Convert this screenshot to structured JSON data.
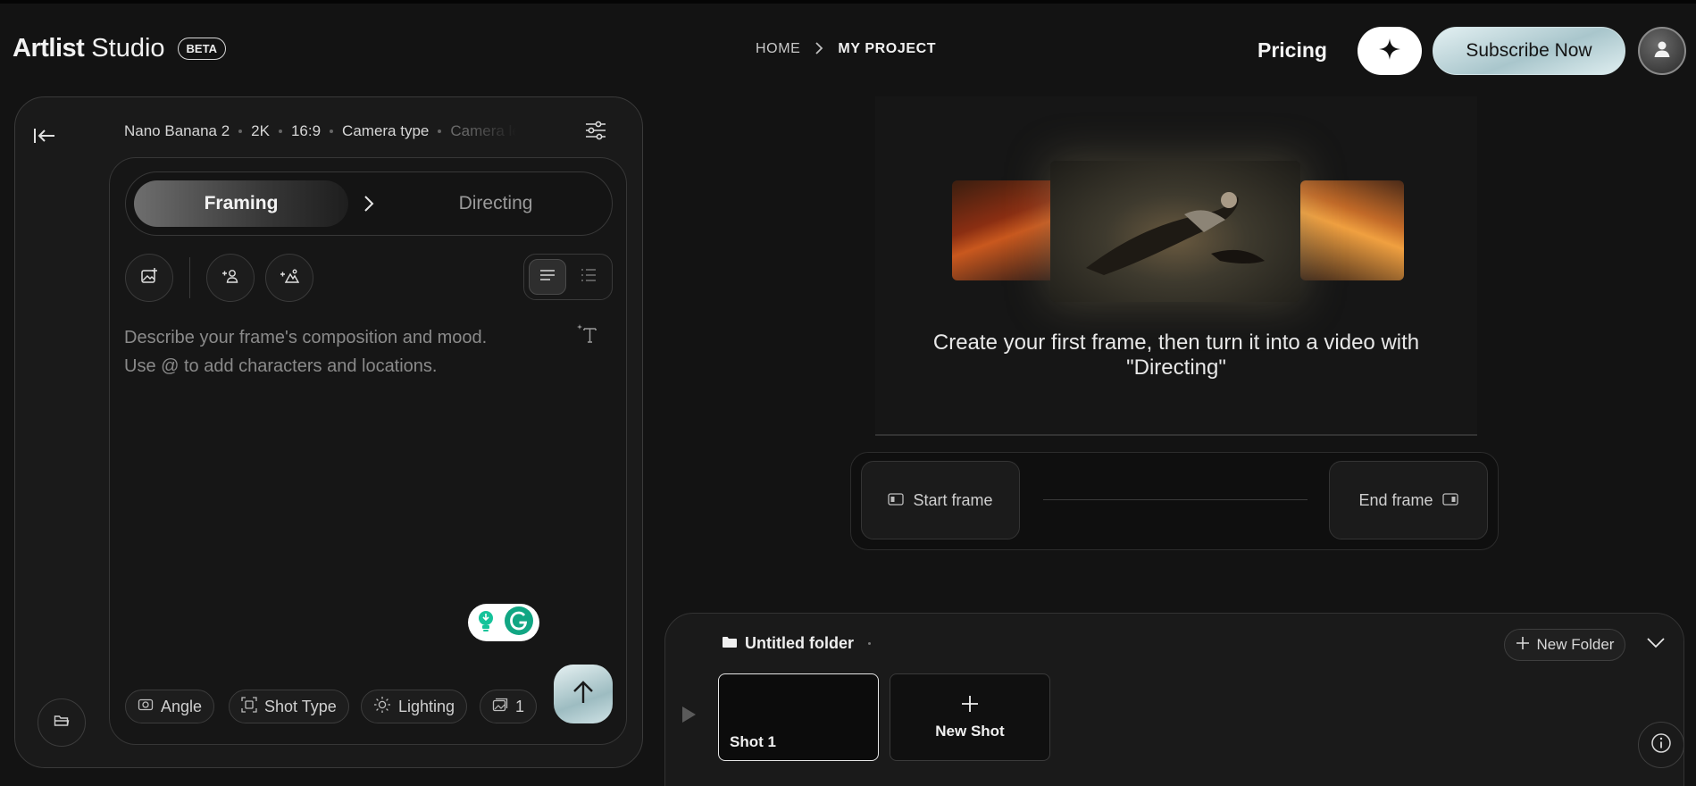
{
  "header": {
    "brand": "Artlist",
    "product": "Studio",
    "badge": "BETA",
    "breadcrumb": {
      "home": "HOME",
      "current": "MY PROJECT"
    },
    "pricing": "Pricing",
    "subscribe": "Subscribe Now"
  },
  "settings": {
    "model": "Nano Banana 2",
    "resolution": "2K",
    "aspect": "16:9",
    "camera_type": "Camera type",
    "camera_truncated": "Camera le"
  },
  "modes": {
    "framing": "Framing",
    "directing": "Directing",
    "active": "Framing"
  },
  "prompt": {
    "placeholder_line1": "Describe your frame's composition and mood.",
    "placeholder_line2": "Use @ to add characters and locations."
  },
  "chips": {
    "angle": "Angle",
    "shot_type": "Shot Type",
    "lighting": "Lighting",
    "images_count": "1"
  },
  "preview": {
    "message": "Create your first frame, then turn it into a video with \"Directing\""
  },
  "frames": {
    "start": "Start frame",
    "end": "End frame"
  },
  "shots": {
    "folder_name": "Untitled folder",
    "new_folder": "New Folder",
    "items": [
      {
        "label": "Shot 1"
      }
    ],
    "new_shot": "New Shot"
  },
  "colors": {
    "background": "#131313",
    "panel": "#1a1a1a",
    "accent_mint": "#a9c6cc",
    "grammarly_green": "#15c39a"
  }
}
